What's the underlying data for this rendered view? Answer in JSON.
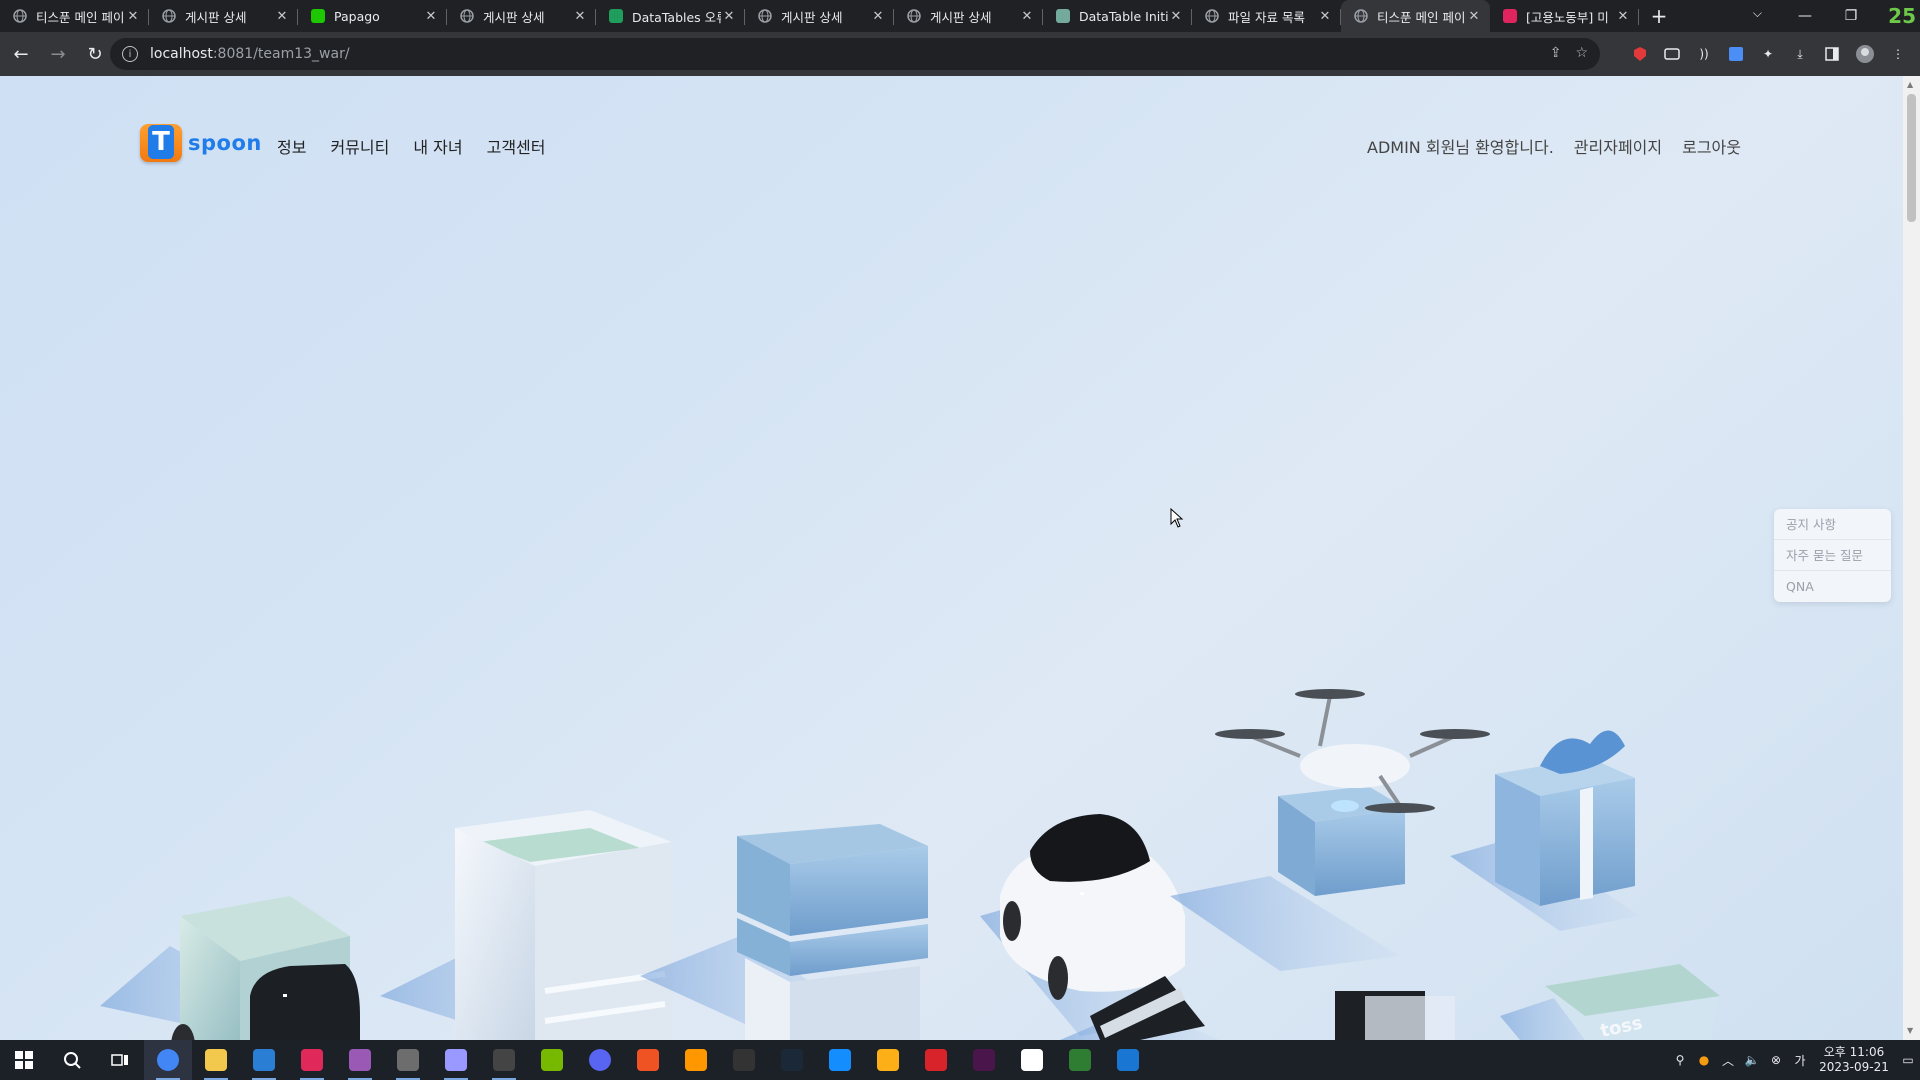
{
  "browser": {
    "tabs": [
      {
        "title": "티스푼 메인 페이지",
        "icon": "globe-icon"
      },
      {
        "title": "게시판 상세",
        "icon": "globe-icon"
      },
      {
        "title": "Papago",
        "icon": "papago-icon"
      },
      {
        "title": "게시판 상세",
        "icon": "globe-icon"
      },
      {
        "title": "DataTables 오류",
        "icon": "datatables-icon"
      },
      {
        "title": "게시판 상세",
        "icon": "globe-icon"
      },
      {
        "title": "게시판 상세",
        "icon": "globe-icon"
      },
      {
        "title": "DataTable Initia",
        "icon": "openai-icon"
      },
      {
        "title": "파일 자료 목록",
        "icon": "globe-icon"
      },
      {
        "title": "티스푼 메인 페이지",
        "icon": "globe-icon",
        "active": true
      },
      {
        "title": "[고용노동부] 미",
        "icon": "zum-icon"
      }
    ],
    "corner_badge": "25",
    "url_host": "localhost",
    "url_path": ":8081/team13_war/"
  },
  "site": {
    "logo_text": "spoon",
    "logo_mark": "T",
    "nav": [
      "정보",
      "커뮤니티",
      "내 자녀",
      "고객센터"
    ],
    "welcome": "ADMIN 회원님 환영합니다.",
    "admin_link": "관리자페이지",
    "logout": "로그아웃",
    "quick_menu": [
      "공지 사항",
      "자주 묻는 질문",
      "QNA"
    ],
    "hero_card_text": "toss"
  },
  "taskbar": {
    "apps": [
      "start-icon",
      "search-icon",
      "task-view-icon",
      "chrome-icon",
      "explorer-icon",
      "vscode-icon",
      "intellij-icon",
      "premiere-icon",
      "davinci-icon",
      "aftereffects-icon",
      "obs-icon",
      "nvidia-icon",
      "discord-icon",
      "ea-icon",
      "sublime-icon",
      "epic-icon",
      "steam-icon",
      "battlenet-icon",
      "rockstar-icon",
      "nexon-icon",
      "slack-icon",
      "notion-icon",
      "hs-icon",
      "jetbrains-icon"
    ],
    "time": "오후 11:06",
    "date": "2023-09-21"
  },
  "colors": {
    "brand_blue": "#1f7ce8",
    "brand_orange": "#f07a12",
    "hero_bg": "#d5e4f4"
  }
}
